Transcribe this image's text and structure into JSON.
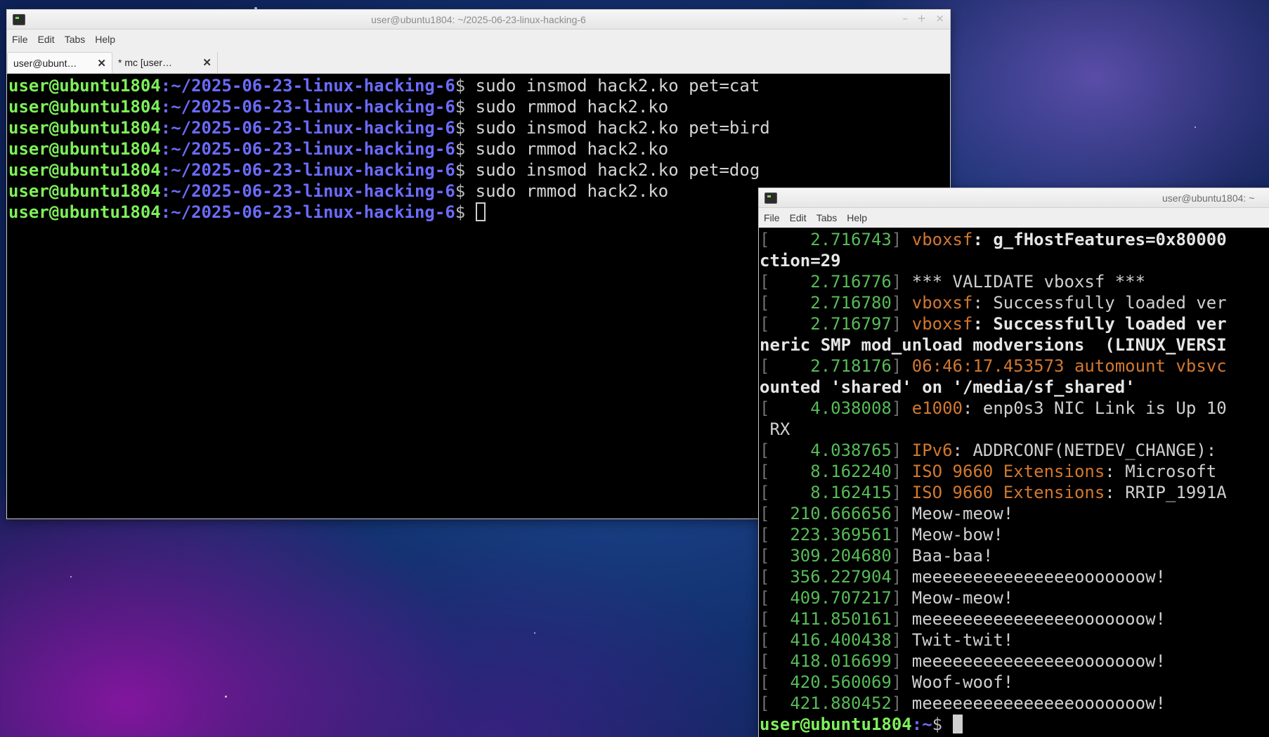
{
  "window1": {
    "title": "user@ubuntu1804: ~/2025-06-23-linux-hacking-6",
    "menu": [
      "File",
      "Edit",
      "Tabs",
      "Help"
    ],
    "tabs": [
      {
        "label": "user@ubunt…",
        "close": "✕"
      },
      {
        "label": "* mc [user…",
        "close": "✕"
      }
    ],
    "controls": {
      "minimize": "–",
      "maximize": "+",
      "close": "×"
    },
    "prompt_user": "user@ubuntu1804",
    "prompt_path": ":~/2025-06-23-linux-hacking-6",
    "prompt_sym": "$",
    "lines": [
      "sudo insmod hack2.ko pet=cat",
      "sudo rmmod hack2.ko",
      "sudo insmod hack2.ko pet=bird",
      "sudo rmmod hack2.ko",
      "sudo insmod hack2.ko pet=dog",
      "sudo rmmod hack2.ko",
      ""
    ]
  },
  "window2": {
    "title": "user@ubuntu1804: ~",
    "menu": [
      "File",
      "Edit",
      "Tabs",
      "Help"
    ],
    "dmesg": [
      {
        "ts": "2.716743",
        "mod": "vboxsf",
        "msg": ": g_fHostFeatures=0x80000",
        "bold": true
      },
      {
        "cont": "ction=29",
        "bold": true
      },
      {
        "ts": "2.716776",
        "mod": "",
        "msg": "*** VALIDATE vboxsf ***",
        "bold": false
      },
      {
        "ts": "2.716780",
        "mod": "vboxsf",
        "msg": ": Successfully loaded ver",
        "bold": false
      },
      {
        "ts": "2.716797",
        "mod": "vboxsf",
        "msg": ": Successfully loaded ver",
        "bold": true
      },
      {
        "cont": "neric SMP mod_unload modversions  (LINUX_VERSI",
        "bold": true
      },
      {
        "ts": "2.718176",
        "mod": "06:46:17.453573 automount vbsvc",
        "msg": "",
        "bold": false
      },
      {
        "cont": "ounted 'shared' on '/media/sf_shared'",
        "bold": true
      },
      {
        "ts": "4.038008",
        "mod": "e1000",
        "msg": ": enp0s3 NIC Link is Up 10",
        "bold": false
      },
      {
        "cont": " RX",
        "bold": false
      },
      {
        "ts": "4.038765",
        "mod": "IPv6",
        "msg": ": ADDRCONF(NETDEV_CHANGE): ",
        "bold": false
      },
      {
        "ts": "8.162240",
        "mod": "ISO 9660 Extensions",
        "msg": ": Microsoft",
        "bold": false
      },
      {
        "ts": "8.162415",
        "mod": "ISO 9660 Extensions",
        "msg": ": RRIP_1991A",
        "bold": false
      },
      {
        "ts": "210.666656",
        "mod": "",
        "msg": "Meow-meow!",
        "bold": false
      },
      {
        "ts": "223.369561",
        "mod": "",
        "msg": "Meow-bow!",
        "bold": false
      },
      {
        "ts": "309.204680",
        "mod": "",
        "msg": "Baa-baa!",
        "bold": false
      },
      {
        "ts": "356.227904",
        "mod": "",
        "msg": "meeeeeeeeeeeeeeeooooooow!",
        "bold": false
      },
      {
        "ts": "409.707217",
        "mod": "",
        "msg": "Meow-meow!",
        "bold": false
      },
      {
        "ts": "411.850161",
        "mod": "",
        "msg": "meeeeeeeeeeeeeeeooooooow!",
        "bold": false
      },
      {
        "ts": "416.400438",
        "mod": "",
        "msg": "Twit-twit!",
        "bold": false
      },
      {
        "ts": "418.016699",
        "mod": "",
        "msg": "meeeeeeeeeeeeeeeooooooow!",
        "bold": false
      },
      {
        "ts": "420.560069",
        "mod": "",
        "msg": "Woof-woof!",
        "bold": false
      },
      {
        "ts": "421.880452",
        "mod": "",
        "msg": "meeeeeeeeeeeeeeeooooooow!",
        "bold": false
      }
    ],
    "prompt_user": "user@ubuntu1804",
    "prompt_path": ":~",
    "prompt_sym": "$"
  }
}
